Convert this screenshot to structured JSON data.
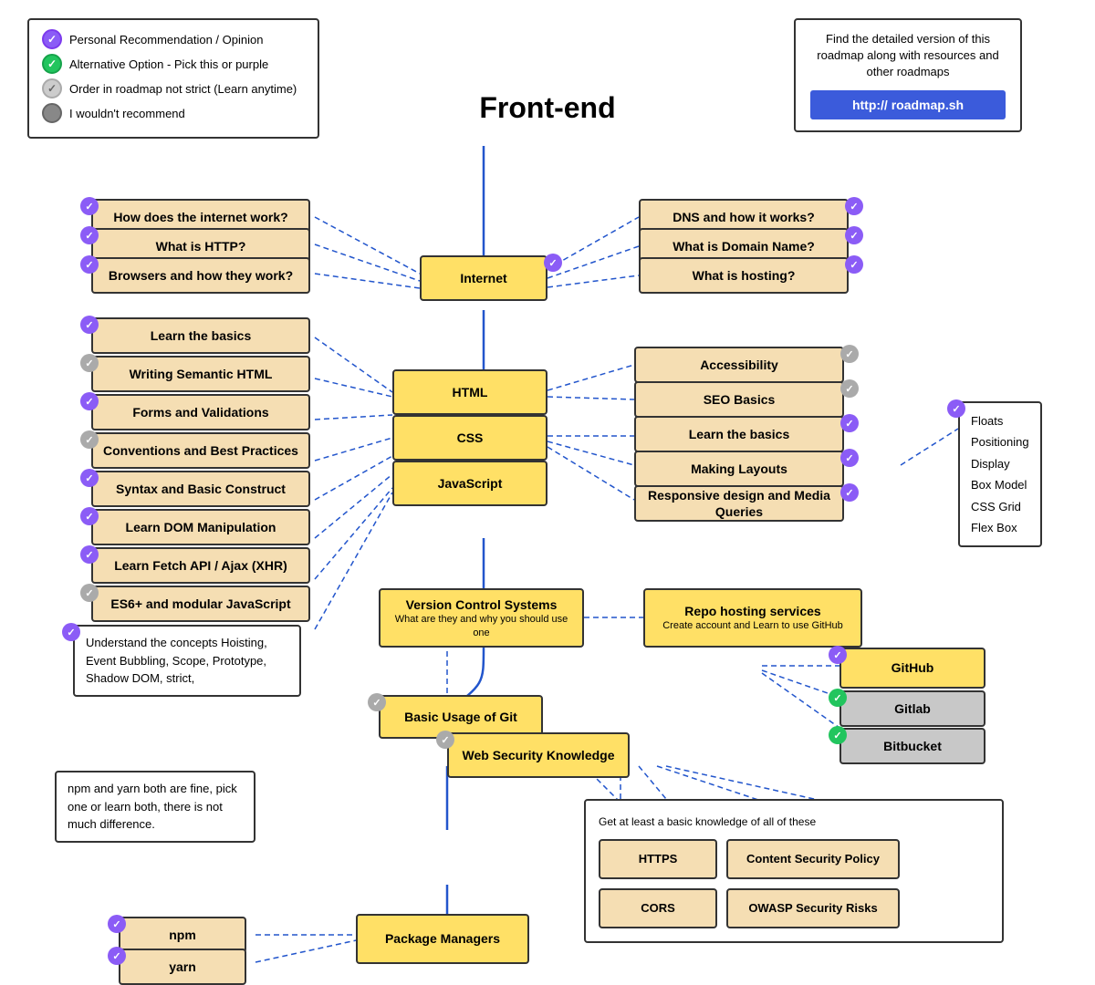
{
  "title": "Front-end",
  "legend": {
    "items": [
      {
        "label": "Personal Recommendation / Opinion"
      },
      {
        "label": "Alternative Option - Pick this or purple"
      },
      {
        "label": "Order in roadmap not strict (Learn anytime)"
      },
      {
        "label": "I wouldn't recommend"
      }
    ]
  },
  "infoBox": {
    "text": "Find the detailed version of this roadmap along with resources and other roadmaps",
    "url": "http:// roadmap.sh"
  },
  "nodes": {
    "internet": {
      "label": "Internet"
    },
    "howInternet": {
      "label": "How does the internet work?"
    },
    "http": {
      "label": "What is HTTP?"
    },
    "browsers": {
      "label": "Browsers and how they work?"
    },
    "dns": {
      "label": "DNS and how it works?"
    },
    "domain": {
      "label": "What is Domain Name?"
    },
    "hosting": {
      "label": "What is hosting?"
    },
    "html": {
      "label": "HTML"
    },
    "css": {
      "label": "CSS"
    },
    "javascript": {
      "label": "JavaScript"
    },
    "learnBasicsHTML": {
      "label": "Learn the basics"
    },
    "semanticHTML": {
      "label": "Writing Semantic HTML"
    },
    "forms": {
      "label": "Forms and Validations"
    },
    "conventions": {
      "label": "Conventions and Best Practices"
    },
    "syntax": {
      "label": "Syntax and Basic Construct"
    },
    "dom": {
      "label": "Learn DOM Manipulation"
    },
    "fetch": {
      "label": "Learn Fetch API / Ajax (XHR)"
    },
    "es6": {
      "label": "ES6+ and modular JavaScript"
    },
    "concepts": {
      "label": "Understand the concepts\nHoisting, Event Bubbling, Scope,\nPrototype, Shadow DOM, strict,"
    },
    "accessibility": {
      "label": "Accessibility"
    },
    "seo": {
      "label": "SEO Basics"
    },
    "learnBasicsCSS": {
      "label": "Learn the basics"
    },
    "makingLayouts": {
      "label": "Making Layouts"
    },
    "responsive": {
      "label": "Responsive design and Media Queries"
    },
    "vcs": {
      "label": "Version Control Systems",
      "subtitle": "What are they and why you should use one"
    },
    "repoHosting": {
      "label": "Repo hosting services",
      "subtitle": "Create account and Learn to use GitHub"
    },
    "git": {
      "label": "Basic Usage of Git"
    },
    "github": {
      "label": "GitHub"
    },
    "gitlab": {
      "label": "Gitlab"
    },
    "bitbucket": {
      "label": "Bitbucket"
    },
    "security": {
      "label": "Web Security Knowledge"
    },
    "npm": {
      "label": "npm"
    },
    "yarn": {
      "label": "yarn"
    },
    "packageManagers": {
      "label": "Package Managers"
    }
  },
  "sublistCSS": {
    "items": [
      "Floats",
      "Positioning",
      "Display",
      "Box Model",
      "CSS Grid",
      "Flex Box"
    ]
  },
  "securityBox": {
    "subtitle": "Get at least a basic knowledge of all of these",
    "items": [
      "HTTPS",
      "Content Security Policy",
      "CORS",
      "OWASP Security Risks"
    ]
  },
  "notes": {
    "packageManagers": "npm and yarn both are fine, pick one or learn both, there is not much difference."
  }
}
